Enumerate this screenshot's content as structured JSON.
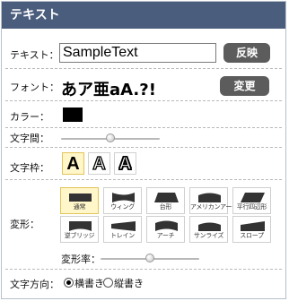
{
  "panel": {
    "title": "テキスト"
  },
  "text_row": {
    "label": "テキスト：",
    "value": "SampleText",
    "apply_label": "反映"
  },
  "font_row": {
    "label": "フォント：",
    "sample": "あア亜aA.?!",
    "change_label": "変更"
  },
  "color_row": {
    "label": "カラー：",
    "color": "#000000"
  },
  "spacing_row": {
    "label": "文字間：",
    "value": 0.5
  },
  "frame_row": {
    "label": "文字枠：",
    "options": [
      {
        "name": "none",
        "glyph": "A"
      },
      {
        "name": "outline",
        "glyph": "A"
      },
      {
        "name": "double-outline",
        "glyph": "A"
      }
    ],
    "selected": 0
  },
  "transform_row": {
    "label": "変形：",
    "shapes": [
      {
        "label": "通常"
      },
      {
        "label": "ウィング"
      },
      {
        "label": "台形"
      },
      {
        "label": "アメリカンアーチ"
      },
      {
        "label": "平行四辺形"
      },
      {
        "label": "逆ブリッジ"
      },
      {
        "label": "トレイン"
      },
      {
        "label": "アーチ"
      },
      {
        "label": "サンライズ"
      },
      {
        "label": "スロープ"
      }
    ],
    "selected": 0,
    "rate_label": "変形率：",
    "rate_value": 0.5
  },
  "direction_row": {
    "label": "文字方向：",
    "horizontal_label": "横書き",
    "vertical_label": "縦書き",
    "selected": "horizontal"
  }
}
